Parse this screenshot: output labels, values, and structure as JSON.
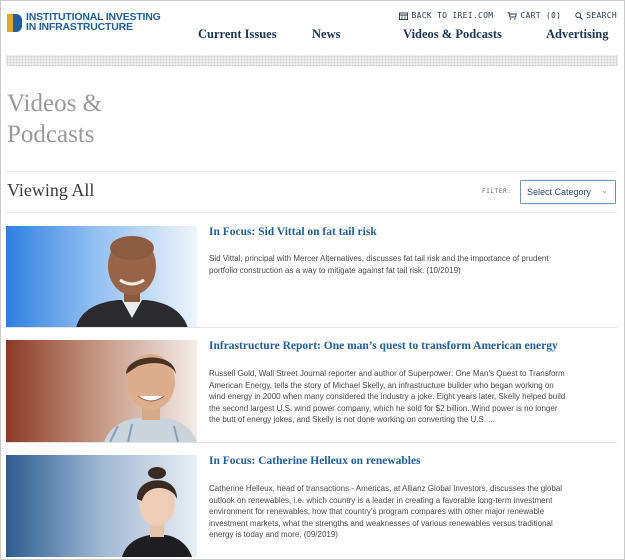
{
  "header": {
    "logo_line1": "INSTITUTIONAL INVESTING",
    "logo_line2": "IN INFRASTRUCTURE",
    "utility": {
      "back_label": "BACK TO IREI.COM",
      "cart_label": "CART (0)",
      "search_label": "SEARCH"
    },
    "nav": [
      "Current Issues",
      "News",
      "Videos & Podcasts",
      "Advertising"
    ]
  },
  "page": {
    "title_line1": "Videos &",
    "title_line2": "Podcasts",
    "viewing_label": "Viewing All",
    "filter_label": "FILTER:",
    "filter_select_value": "Select Category"
  },
  "items": [
    {
      "title": "In Focus: Sid Vittal on fat tail risk",
      "desc_lines": [
        "Sid Vittal, principal with Mercer Alternatives, discusses fat tail risk and the importance of prudent",
        "portfolio construction as a way to mitigate against fat tail risk. (10/2019)"
      ]
    },
    {
      "title": "Infrastructure Report: One man’s quest to transform American energy",
      "desc_lines": [
        "Russell Gold, Wall Street Journal reporter and author of Superpower: One Man’s Quest to Transform",
        "American Energy, tells the story of Michael Skelly, an infrastructure builder who began working on",
        "wind energy in 2000 when many considered the industry a joke. Eight years later, Skelly helped build",
        "the second largest U.S. wind power company, which he sold for $2 billion. Wind power is no longer",
        "the butt of energy jokes, and Skelly is not done working on converting the U.S. ..."
      ]
    },
    {
      "title": "In Focus: Catherine Helleux on renewables",
      "desc_lines": [
        "Catherine Helleux, head of transactions - Americas, at Allianz Global Investors, discusses the global",
        "outlook on renewables, i.e. which country is a leader in creating a favorable long-term investment",
        "environment for renewables, how that country’s program compares with other major renewable",
        "investment markets, what the strengths and weaknesses of various renewables versus traditional",
        "energy is today and more. (09/2019)"
      ]
    }
  ],
  "colors": {
    "brand_blue": "#1e5fa3",
    "brand_gold": "#e3a52a",
    "nav_text": "#1c3557",
    "title_gray": "#9a9a9a"
  }
}
